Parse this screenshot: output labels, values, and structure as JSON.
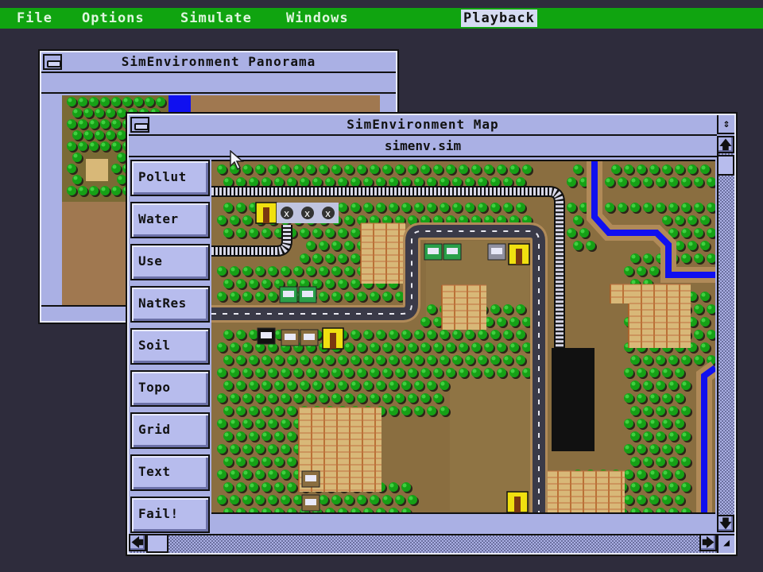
{
  "menubar": {
    "items": [
      {
        "label": "File"
      },
      {
        "label": "Options"
      },
      {
        "label": "Simulate"
      },
      {
        "label": "Windows"
      },
      {
        "label": "Playback",
        "active": true
      }
    ],
    "color": "#10a410"
  },
  "panorama": {
    "title": "SimEnvironment Panorama",
    "icons": {
      "close": "close-box-icon"
    }
  },
  "map_window": {
    "title": "SimEnvironment Map",
    "filename": "simenv.sim",
    "icons": {
      "close": "close-box-icon",
      "zoom": "updown-arrow-icon",
      "scroll_up": "up-arrow-icon",
      "scroll_down": "down-arrow-icon",
      "scroll_left": "left-arrow-icon",
      "scroll_right": "right-arrow-icon",
      "grow": "resize-corner-icon"
    },
    "glyphs": {
      "zoom": "⇕",
      "up": "🡅",
      "down": "🡇",
      "left": "🡄",
      "right": "🡆",
      "grow": "◢"
    },
    "tools": [
      {
        "label": "Pollut"
      },
      {
        "label": "Water"
      },
      {
        "label": "Use"
      },
      {
        "label": "NatRes"
      },
      {
        "label": "Soil"
      },
      {
        "label": "Topo"
      },
      {
        "label": "Grid"
      },
      {
        "label": "Text"
      },
      {
        "label": "Fail!"
      }
    ]
  },
  "colors": {
    "window_bg": "#aab0e4",
    "terrain": "#927045",
    "tree": "#1aa01a",
    "river": "#1010f0",
    "road": "#3a3a48",
    "field": "#d8b878",
    "building_yellow": "#f0e010"
  }
}
